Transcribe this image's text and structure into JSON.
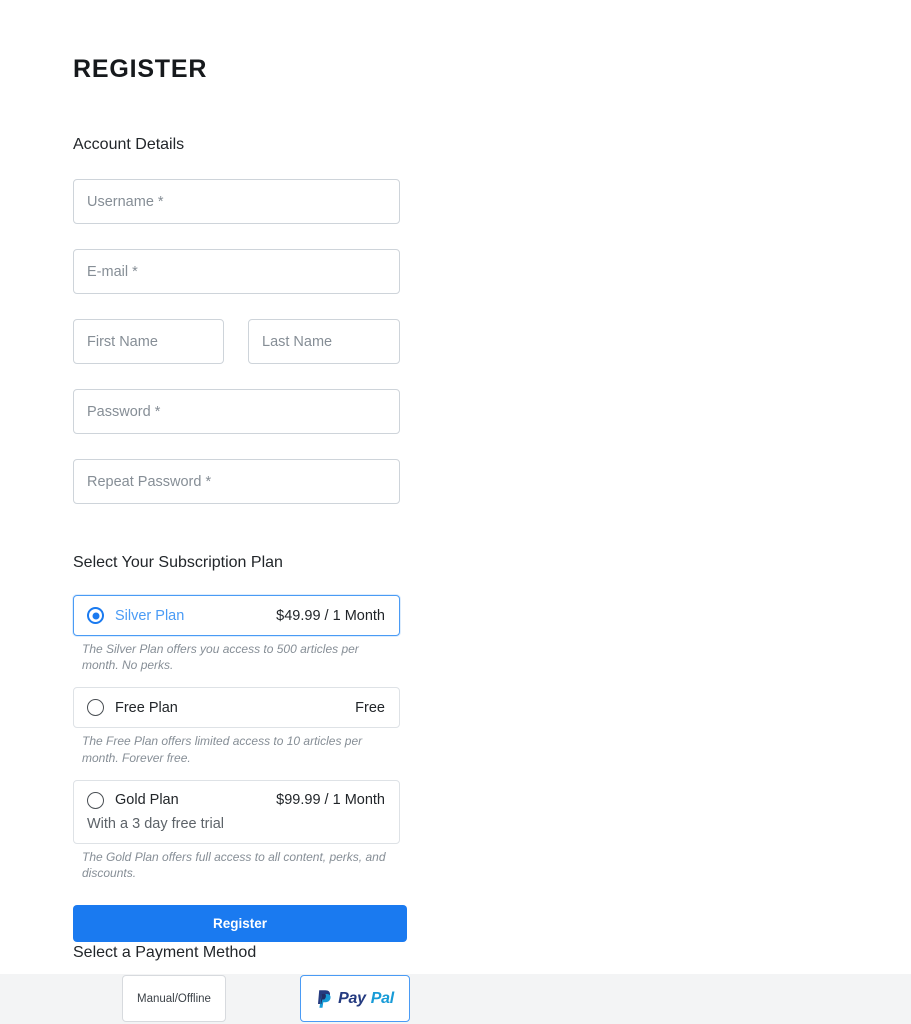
{
  "page": {
    "title": "REGISTER",
    "background_color": "#ffffff",
    "accent_color": "#1a7af0"
  },
  "account_section": {
    "heading": "Account Details",
    "fields": [
      {
        "name": "username",
        "placeholder": "Username *",
        "value": ""
      },
      {
        "name": "email",
        "placeholder": "E-mail *",
        "value": ""
      },
      {
        "name": "first_name",
        "placeholder": "First Name",
        "value": ""
      },
      {
        "name": "last_name",
        "placeholder": "Last Name",
        "value": ""
      },
      {
        "name": "password",
        "placeholder": "Password *",
        "value": ""
      },
      {
        "name": "repeat_password",
        "placeholder": "Repeat Password *",
        "value": ""
      }
    ]
  },
  "plan_section": {
    "heading": "Select Your Subscription Plan",
    "plans": [
      {
        "name": "Silver Plan",
        "price": "$49.99 / 1 Month",
        "subtext": "",
        "description": "The Silver Plan offers you access to 500 articles per month. No perks.",
        "selected": true
      },
      {
        "name": "Free Plan",
        "price": "Free",
        "subtext": "",
        "description": "The Free Plan offers limited access to 10 articles per month. Forever free.",
        "selected": false
      },
      {
        "name": "Gold Plan",
        "price": "$99.99 / 1 Month",
        "subtext": "With a 3 day free trial",
        "description": "The Gold Plan offers full access to all content, perks, and discounts.",
        "selected": false
      }
    ]
  },
  "submit": {
    "label": "Register"
  },
  "payment_section": {
    "heading": "Select a Payment Method",
    "methods": [
      {
        "name": "manual",
        "label": "Manual/Offline",
        "selected": false
      },
      {
        "name": "paypal",
        "label": "PayPal",
        "logo_dark_text": "Pay",
        "logo_light_text": "Pal",
        "selected": true
      }
    ]
  }
}
